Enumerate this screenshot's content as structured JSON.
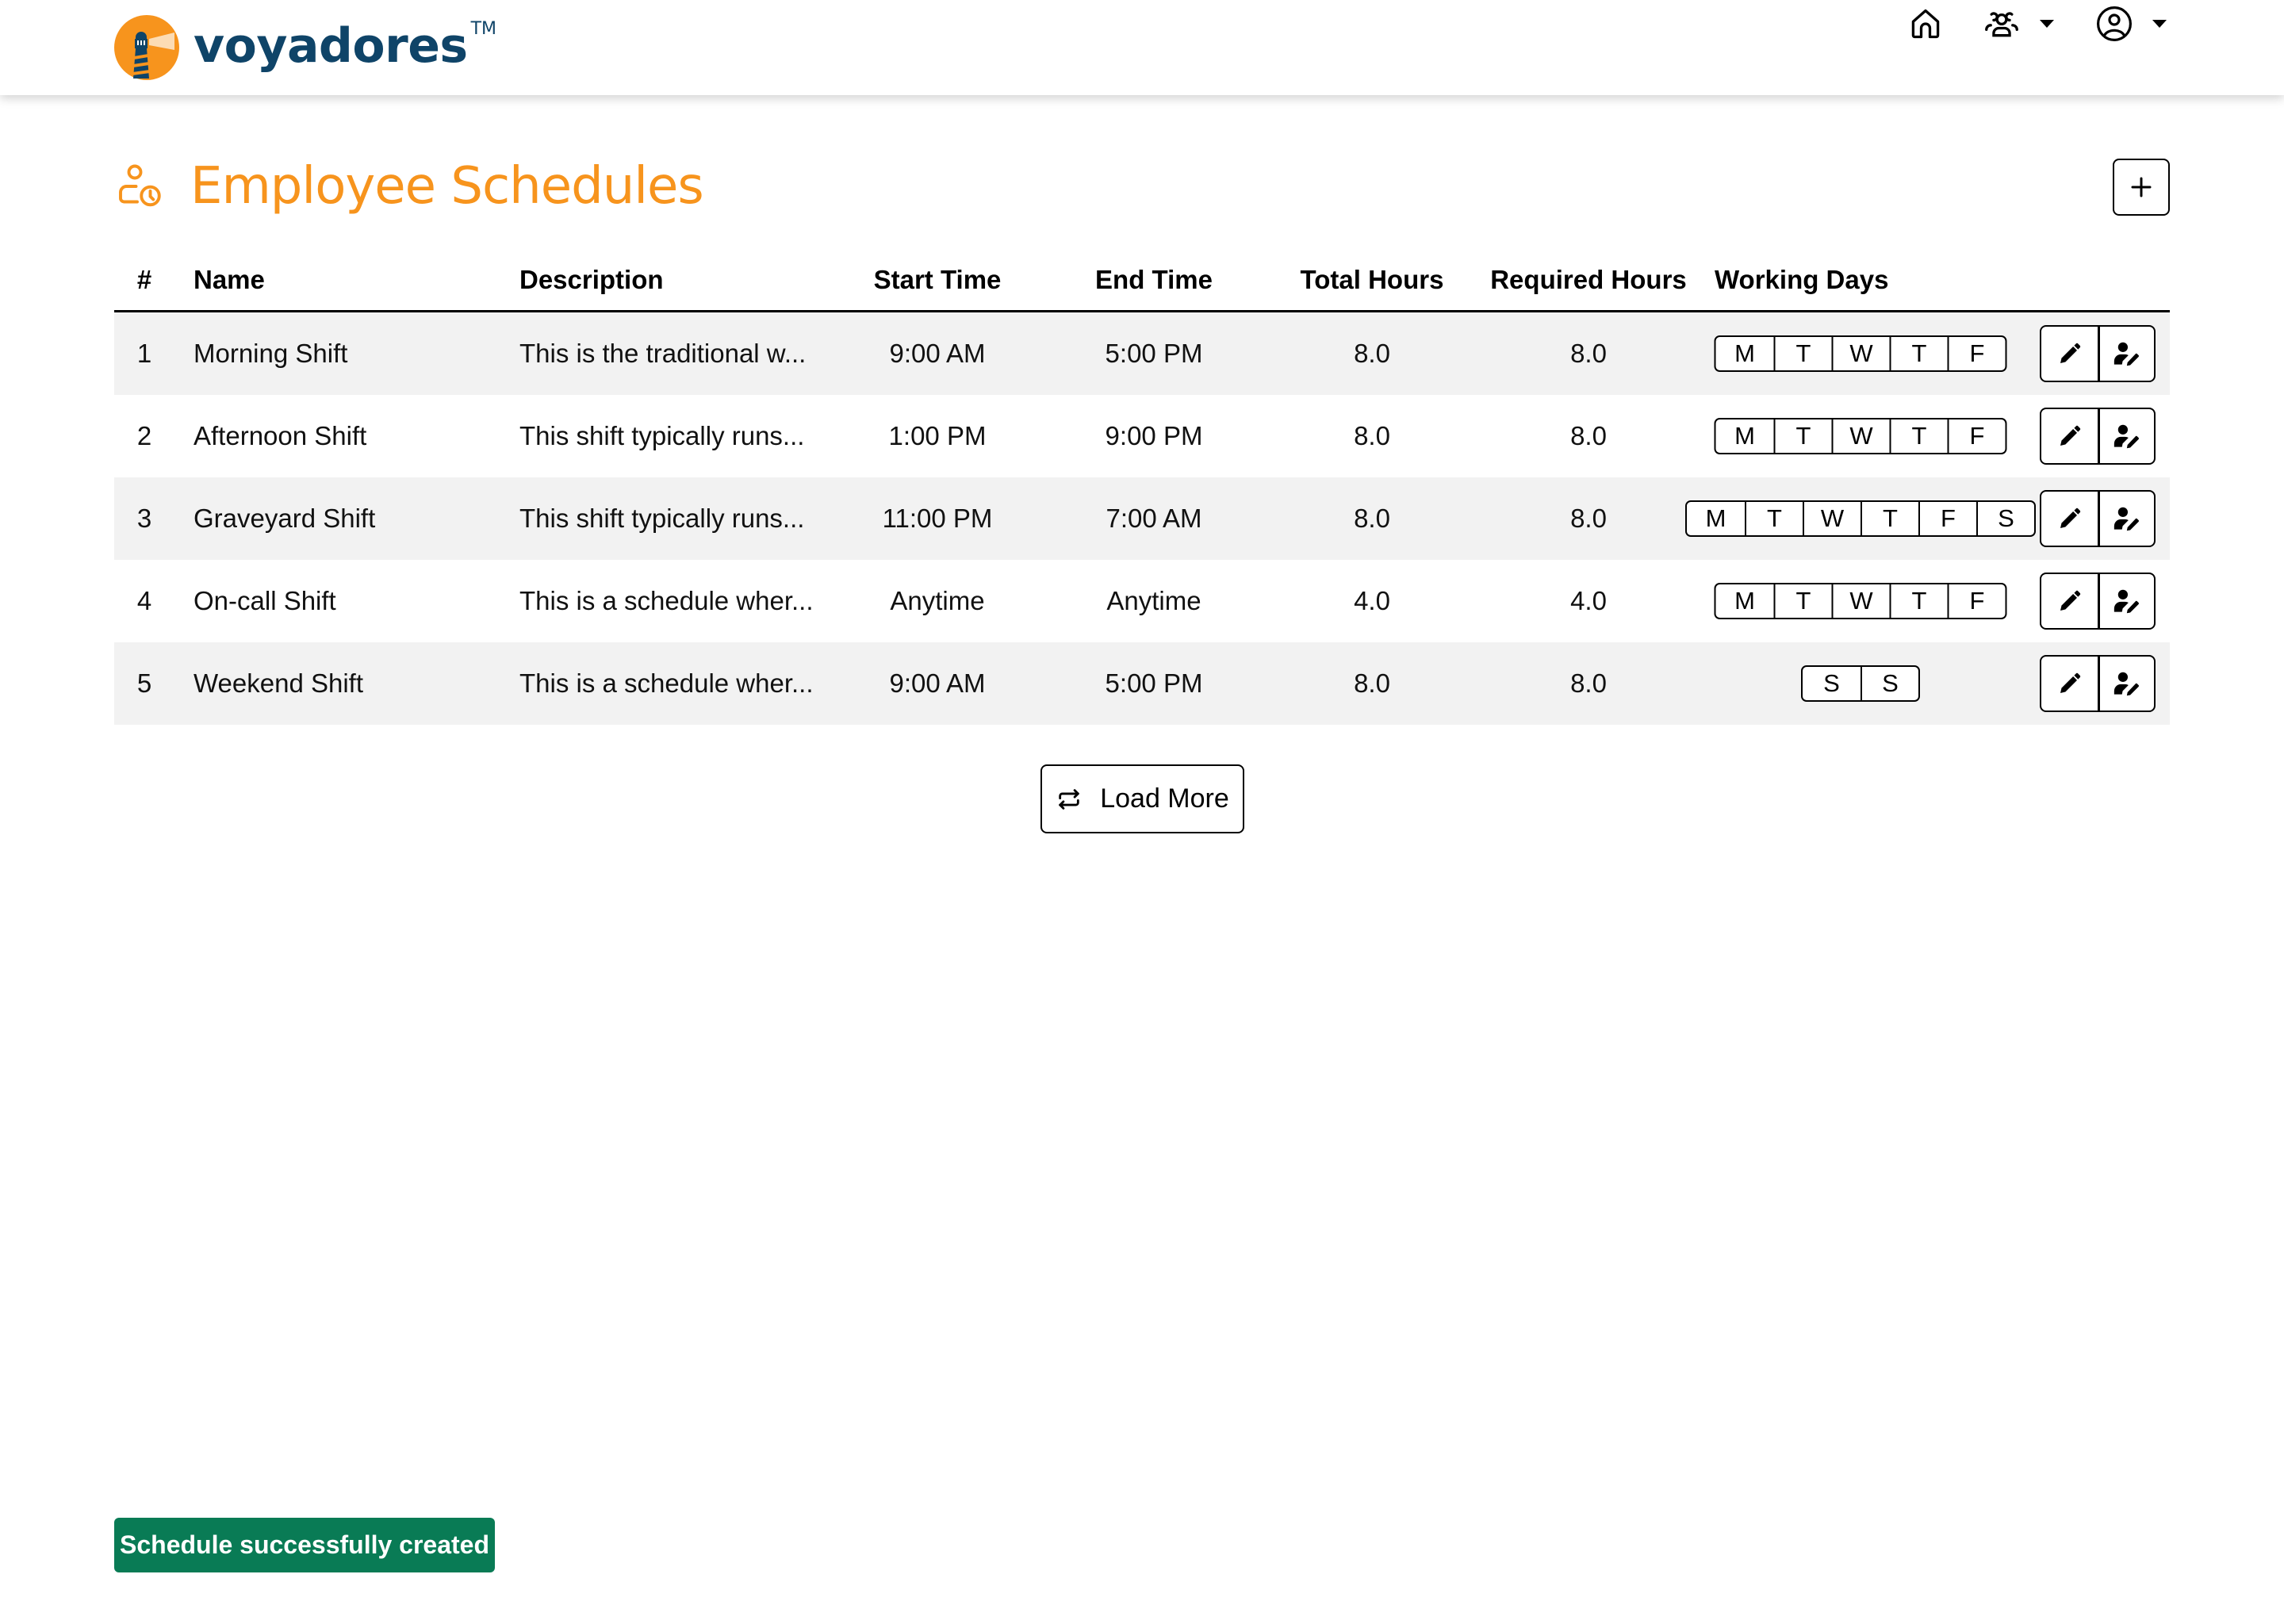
{
  "header": {
    "brand_name": "voyadores",
    "brand_tm": "TM",
    "brand_colors": {
      "orange": "#f7941d",
      "navy": "#0f4468"
    },
    "nav": [
      {
        "icon": "home-icon"
      },
      {
        "icon": "users-icon",
        "dropdown": true
      },
      {
        "icon": "user-circle-icon",
        "dropdown": true
      }
    ]
  },
  "page": {
    "title": "Employee Schedules",
    "title_icon": "user-clock-icon",
    "title_color": "#f7941d",
    "add_button_icon": "plus-icon"
  },
  "table": {
    "columns": [
      "#",
      "Name",
      "Description",
      "Start Time",
      "End Time",
      "Total Hours",
      "Required Hours",
      "Working Days"
    ],
    "rows": [
      {
        "num": "1",
        "name": "Morning Shift",
        "description": "This is the traditional w...",
        "start": "9:00 AM",
        "end": "5:00 PM",
        "total": "8.0",
        "required": "8.0",
        "days": [
          "M",
          "T",
          "W",
          "T",
          "F"
        ]
      },
      {
        "num": "2",
        "name": "Afternoon Shift",
        "description": "This shift typically runs...",
        "start": "1:00 PM",
        "end": "9:00 PM",
        "total": "8.0",
        "required": "8.0",
        "days": [
          "M",
          "T",
          "W",
          "T",
          "F"
        ]
      },
      {
        "num": "3",
        "name": "Graveyard Shift",
        "description": "This shift typically runs...",
        "start": "11:00 PM",
        "end": "7:00 AM",
        "total": "8.0",
        "required": "8.0",
        "days": [
          "M",
          "T",
          "W",
          "T",
          "F",
          "S"
        ]
      },
      {
        "num": "4",
        "name": "On-call Shift",
        "description": "This is a schedule wher...",
        "start": "Anytime",
        "end": "Anytime",
        "total": "4.0",
        "required": "4.0",
        "days": [
          "M",
          "T",
          "W",
          "T",
          "F"
        ]
      },
      {
        "num": "5",
        "name": "Weekend Shift",
        "description": "This is a schedule wher...",
        "start": "9:00 AM",
        "end": "5:00 PM",
        "total": "8.0",
        "required": "8.0",
        "days": [
          "S",
          "S"
        ]
      }
    ],
    "row_actions": [
      {
        "icon": "pencil-icon",
        "label": "edit"
      },
      {
        "icon": "user-edit-icon",
        "label": "assign"
      }
    ]
  },
  "load_more": {
    "label": "Load More",
    "icon": "repeat-icon"
  },
  "toast": {
    "message": "Schedule successfully created",
    "color": "#097b55"
  }
}
